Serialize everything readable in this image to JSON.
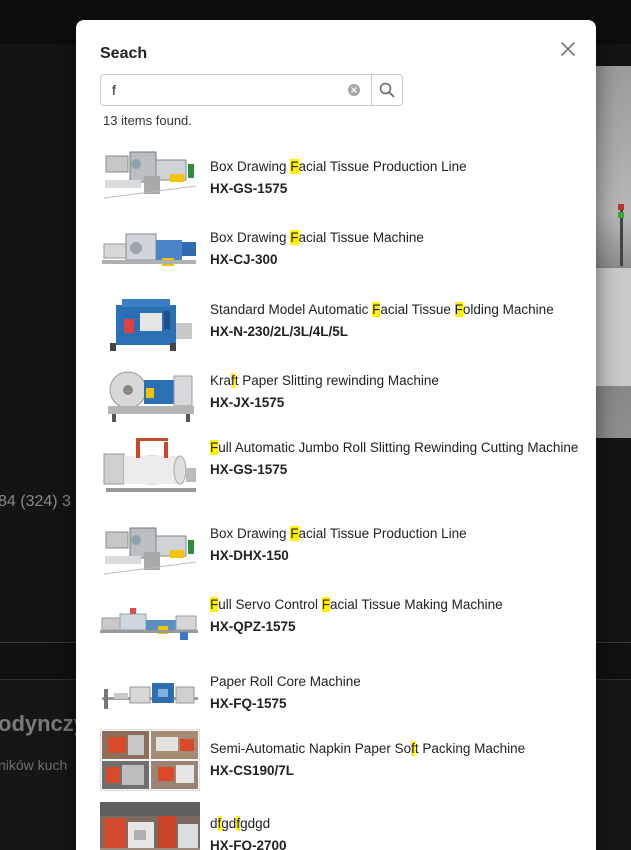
{
  "background": {
    "phone_fragment": "84 (324) 3",
    "heading_fragment": "odynczy",
    "text_fragment": "ników kuch"
  },
  "modal": {
    "title": "Seach",
    "search": {
      "value": "f",
      "placeholder": ""
    },
    "result_count": "13 items found.",
    "highlight_color": "#fff200",
    "results": [
      {
        "name": "Box Drawing Facial Tissue Production Line",
        "model": "HX-GS-1575",
        "thumb": "tissue-line"
      },
      {
        "name": "Box Drawing Facial Tissue Machine",
        "model": "HX-CJ-300",
        "thumb": "tissue-machine-blue"
      },
      {
        "name": "Standard Model Automatic Facial Tissue Folding Machine",
        "model": "HX-N-230/2L/3L/4L/5L",
        "thumb": "folding-machine"
      },
      {
        "name": "Kraft Paper Slitting rewinding Machine",
        "model": "HX-JX-1575",
        "thumb": "slitting-rewinder"
      },
      {
        "name": "Full Automatic Jumbo Roll Slitting Rewinding Cutting Machine",
        "model": "HX-GS-1575",
        "thumb": "jumbo-roll"
      },
      {
        "name": "Box Drawing Facial Tissue Production Line",
        "model": "HX-DHX-150",
        "thumb": "tissue-line"
      },
      {
        "name": "Full Servo Control Facial Tissue Making Machine",
        "model": "HX-QPZ-1575",
        "thumb": "servo-line"
      },
      {
        "name": "Paper Roll Core Machine",
        "model": "HX-FQ-1575",
        "thumb": "core-machine"
      },
      {
        "name": "Semi-Automatic Napkin Paper Soft Packing Machine",
        "model": "HX-CS190/7L",
        "thumb": "packing-collage"
      },
      {
        "name": "dfgdfgdgd",
        "model": "HX-FQ-2700",
        "thumb": "factory-photo"
      }
    ]
  }
}
